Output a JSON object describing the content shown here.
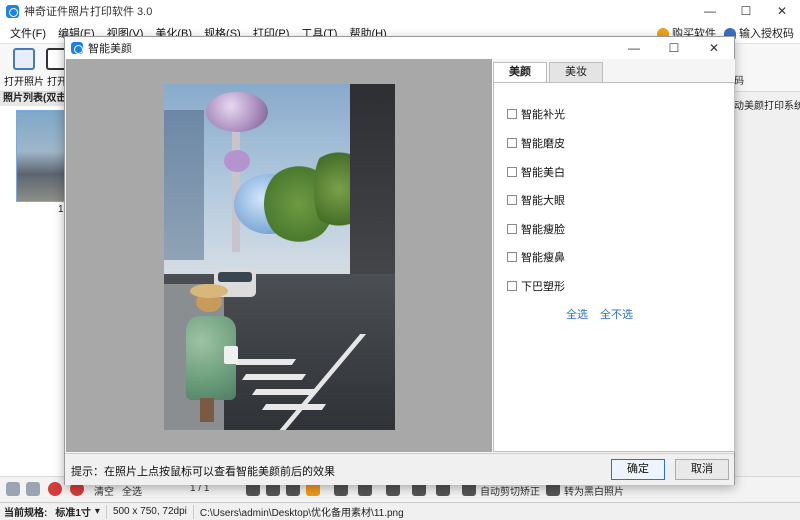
{
  "app": {
    "title": "神奇证件照片打印软件 3.0",
    "window_controls": [
      "—",
      "☐",
      "✕"
    ]
  },
  "menu": {
    "items": [
      "文件(F)",
      "编辑(E)",
      "视图(V)",
      "美化(B)",
      "规格(S)",
      "打印(P)",
      "工具(T)",
      "帮助(H)"
    ],
    "buy": "购买软件",
    "license": "输入授权码"
  },
  "toolbar": {
    "open_photo": "打开照片",
    "open_partial": "打开"
  },
  "photo_list": {
    "header": "照片列表(双击打",
    "thumb_number": "1"
  },
  "right_strip": {
    "partial_a": "码",
    "partial_b": "动美颜打印系统"
  },
  "bottom_toolbar": {
    "clear": "清空",
    "select_all": "全选",
    "page": "1 / 1",
    "auto_crop": "自动剪切矫正",
    "to_bw": "转为黑白照片"
  },
  "statusbar": {
    "label": "当前规格:",
    "spec": "标准1寸",
    "size": "500 x 750, 72dpi",
    "path": "C:\\Users\\admin\\Desktop\\优化备用素材\\11.png"
  },
  "dialog": {
    "title": "智能美颜",
    "controls": [
      "—",
      "☐",
      "✕"
    ],
    "tabs": [
      "美颜",
      "美妆"
    ],
    "options": [
      "智能补光",
      "智能磨皮",
      "智能美白",
      "智能大眼",
      "智能瘦脸",
      "智能瘦鼻",
      "下巴塑形"
    ],
    "select_all": "全选",
    "select_none": "全不选",
    "hint": "提示：在照片上点按鼠标可以查看智能美颜前后的效果",
    "ok": "确定",
    "cancel": "取消"
  }
}
